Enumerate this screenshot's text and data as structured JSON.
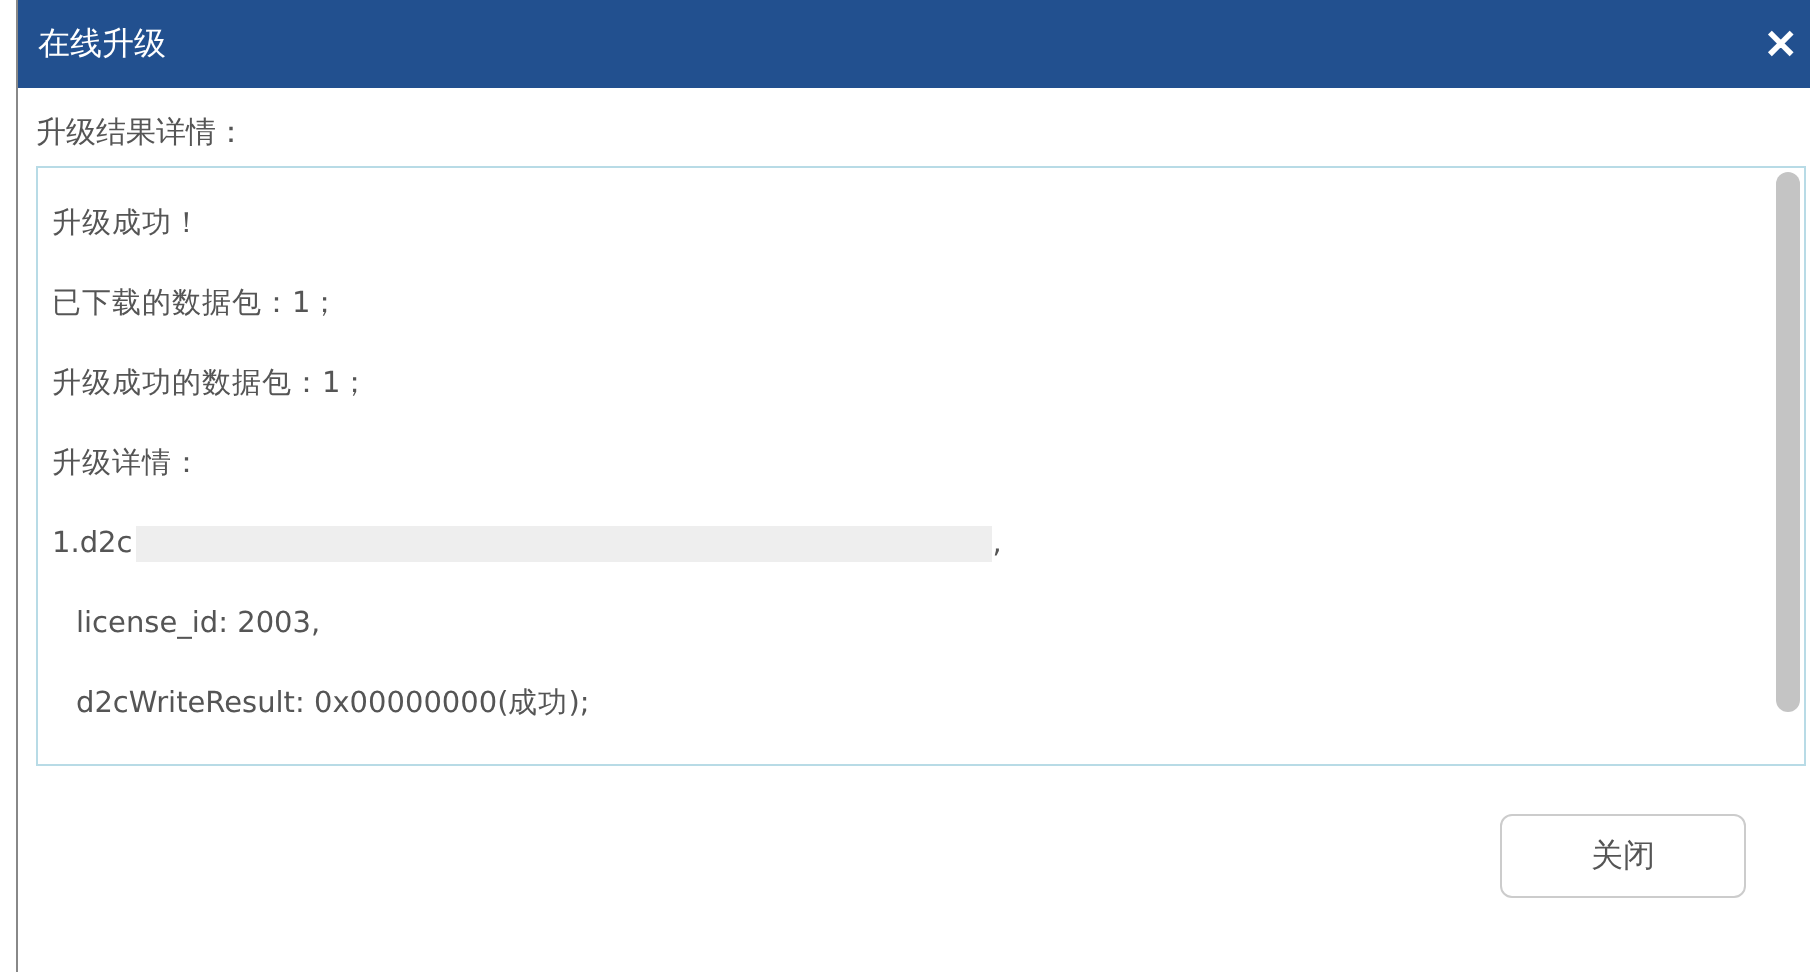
{
  "window": {
    "title": "在线升级",
    "close": "✕"
  },
  "result_label": "升级结果详情：",
  "result_lines": [
    {
      "kind": "plain",
      "text": "升级成功！"
    },
    {
      "kind": "plain",
      "text": "已下载的数据包：1；"
    },
    {
      "kind": "plain",
      "text": "升级成功的数据包：1；"
    },
    {
      "kind": "plain",
      "text": "升级详情："
    },
    {
      "kind": "redacted",
      "text": "1.d2c",
      "tail": ","
    },
    {
      "kind": "indented",
      "text": "license_id: 2003,"
    },
    {
      "kind": "indented",
      "text": "d2cWriteResult: 0x00000000(成功);"
    }
  ],
  "buttons": [
    "关闭"
  ]
}
